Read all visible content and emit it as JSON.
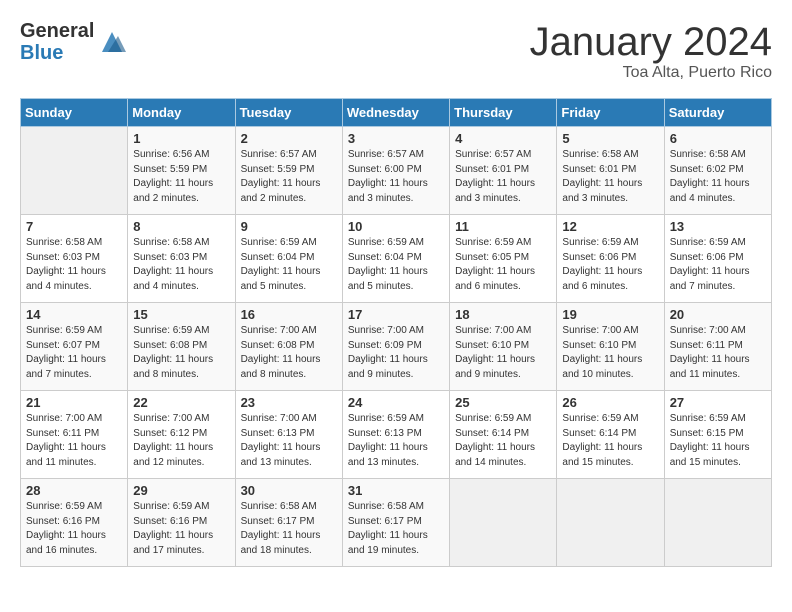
{
  "header": {
    "logo_general": "General",
    "logo_blue": "Blue",
    "month_title": "January 2024",
    "location": "Toa Alta, Puerto Rico"
  },
  "calendar": {
    "days_of_week": [
      "Sunday",
      "Monday",
      "Tuesday",
      "Wednesday",
      "Thursday",
      "Friday",
      "Saturday"
    ],
    "weeks": [
      [
        {
          "day": "",
          "info": ""
        },
        {
          "day": "1",
          "info": "Sunrise: 6:56 AM\nSunset: 5:59 PM\nDaylight: 11 hours\nand 2 minutes."
        },
        {
          "day": "2",
          "info": "Sunrise: 6:57 AM\nSunset: 5:59 PM\nDaylight: 11 hours\nand 2 minutes."
        },
        {
          "day": "3",
          "info": "Sunrise: 6:57 AM\nSunset: 6:00 PM\nDaylight: 11 hours\nand 3 minutes."
        },
        {
          "day": "4",
          "info": "Sunrise: 6:57 AM\nSunset: 6:01 PM\nDaylight: 11 hours\nand 3 minutes."
        },
        {
          "day": "5",
          "info": "Sunrise: 6:58 AM\nSunset: 6:01 PM\nDaylight: 11 hours\nand 3 minutes."
        },
        {
          "day": "6",
          "info": "Sunrise: 6:58 AM\nSunset: 6:02 PM\nDaylight: 11 hours\nand 4 minutes."
        }
      ],
      [
        {
          "day": "7",
          "info": "Sunrise: 6:58 AM\nSunset: 6:03 PM\nDaylight: 11 hours\nand 4 minutes."
        },
        {
          "day": "8",
          "info": "Sunrise: 6:58 AM\nSunset: 6:03 PM\nDaylight: 11 hours\nand 4 minutes."
        },
        {
          "day": "9",
          "info": "Sunrise: 6:59 AM\nSunset: 6:04 PM\nDaylight: 11 hours\nand 5 minutes."
        },
        {
          "day": "10",
          "info": "Sunrise: 6:59 AM\nSunset: 6:04 PM\nDaylight: 11 hours\nand 5 minutes."
        },
        {
          "day": "11",
          "info": "Sunrise: 6:59 AM\nSunset: 6:05 PM\nDaylight: 11 hours\nand 6 minutes."
        },
        {
          "day": "12",
          "info": "Sunrise: 6:59 AM\nSunset: 6:06 PM\nDaylight: 11 hours\nand 6 minutes."
        },
        {
          "day": "13",
          "info": "Sunrise: 6:59 AM\nSunset: 6:06 PM\nDaylight: 11 hours\nand 7 minutes."
        }
      ],
      [
        {
          "day": "14",
          "info": "Sunrise: 6:59 AM\nSunset: 6:07 PM\nDaylight: 11 hours\nand 7 minutes."
        },
        {
          "day": "15",
          "info": "Sunrise: 6:59 AM\nSunset: 6:08 PM\nDaylight: 11 hours\nand 8 minutes."
        },
        {
          "day": "16",
          "info": "Sunrise: 7:00 AM\nSunset: 6:08 PM\nDaylight: 11 hours\nand 8 minutes."
        },
        {
          "day": "17",
          "info": "Sunrise: 7:00 AM\nSunset: 6:09 PM\nDaylight: 11 hours\nand 9 minutes."
        },
        {
          "day": "18",
          "info": "Sunrise: 7:00 AM\nSunset: 6:10 PM\nDaylight: 11 hours\nand 9 minutes."
        },
        {
          "day": "19",
          "info": "Sunrise: 7:00 AM\nSunset: 6:10 PM\nDaylight: 11 hours\nand 10 minutes."
        },
        {
          "day": "20",
          "info": "Sunrise: 7:00 AM\nSunset: 6:11 PM\nDaylight: 11 hours\nand 11 minutes."
        }
      ],
      [
        {
          "day": "21",
          "info": "Sunrise: 7:00 AM\nSunset: 6:11 PM\nDaylight: 11 hours\nand 11 minutes."
        },
        {
          "day": "22",
          "info": "Sunrise: 7:00 AM\nSunset: 6:12 PM\nDaylight: 11 hours\nand 12 minutes."
        },
        {
          "day": "23",
          "info": "Sunrise: 7:00 AM\nSunset: 6:13 PM\nDaylight: 11 hours\nand 13 minutes."
        },
        {
          "day": "24",
          "info": "Sunrise: 6:59 AM\nSunset: 6:13 PM\nDaylight: 11 hours\nand 13 minutes."
        },
        {
          "day": "25",
          "info": "Sunrise: 6:59 AM\nSunset: 6:14 PM\nDaylight: 11 hours\nand 14 minutes."
        },
        {
          "day": "26",
          "info": "Sunrise: 6:59 AM\nSunset: 6:14 PM\nDaylight: 11 hours\nand 15 minutes."
        },
        {
          "day": "27",
          "info": "Sunrise: 6:59 AM\nSunset: 6:15 PM\nDaylight: 11 hours\nand 15 minutes."
        }
      ],
      [
        {
          "day": "28",
          "info": "Sunrise: 6:59 AM\nSunset: 6:16 PM\nDaylight: 11 hours\nand 16 minutes."
        },
        {
          "day": "29",
          "info": "Sunrise: 6:59 AM\nSunset: 6:16 PM\nDaylight: 11 hours\nand 17 minutes."
        },
        {
          "day": "30",
          "info": "Sunrise: 6:58 AM\nSunset: 6:17 PM\nDaylight: 11 hours\nand 18 minutes."
        },
        {
          "day": "31",
          "info": "Sunrise: 6:58 AM\nSunset: 6:17 PM\nDaylight: 11 hours\nand 19 minutes."
        },
        {
          "day": "",
          "info": ""
        },
        {
          "day": "",
          "info": ""
        },
        {
          "day": "",
          "info": ""
        }
      ]
    ]
  }
}
